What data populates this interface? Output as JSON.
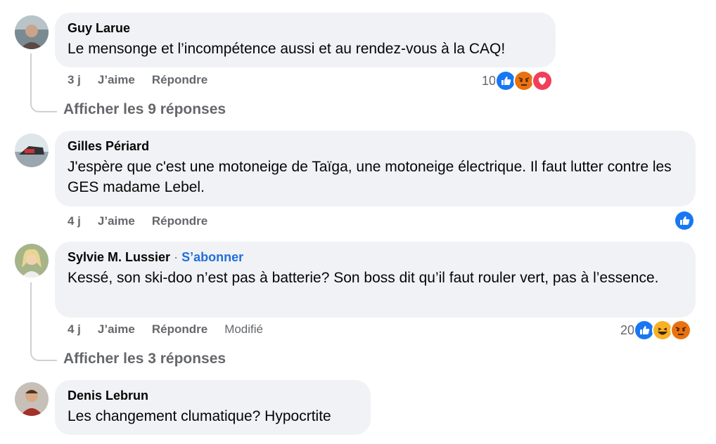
{
  "comments": [
    {
      "author": "Guy Larue",
      "text": "Le mensonge et l’incompétence aussi et au rendez-vous à la CAQ!",
      "time": "3 j",
      "like": "J’aime",
      "reply": "Répondre",
      "reaction_count": "10",
      "replies_label": "Afficher les 9 réponses"
    },
    {
      "author": "Gilles Périard",
      "text": "J'espère que c'est une motoneige de Taïga, une motoneige électrique. Il faut lutter contre les GES madame Lebel.",
      "time": "4 j",
      "like": "J’aime",
      "reply": "Répondre"
    },
    {
      "author": "Sylvie M. Lussier",
      "separator": "·",
      "follow": "S’abonner",
      "text": "Kessé, son ski-doo n’est pas à batterie? Son boss dit qu’il faut rouler vert, pas à l’essence.",
      "time": "4 j",
      "like": "J’aime",
      "reply": "Répondre",
      "edited": "Modifié",
      "reaction_count": "20",
      "replies_label": "Afficher les 3 réponses"
    },
    {
      "author": "Denis Lebrun",
      "text": "Les changement clumatique? Hypocrtite"
    }
  ],
  "colors": {
    "like": "#1877f2",
    "angry": "#e9710f",
    "love": "#f33e58",
    "haha": "#f7b125",
    "bubble": "#f0f2f5",
    "muted": "#65676b",
    "link": "#216fdb"
  },
  "icons": [
    "like-icon",
    "angry-icon",
    "love-icon",
    "haha-icon"
  ]
}
